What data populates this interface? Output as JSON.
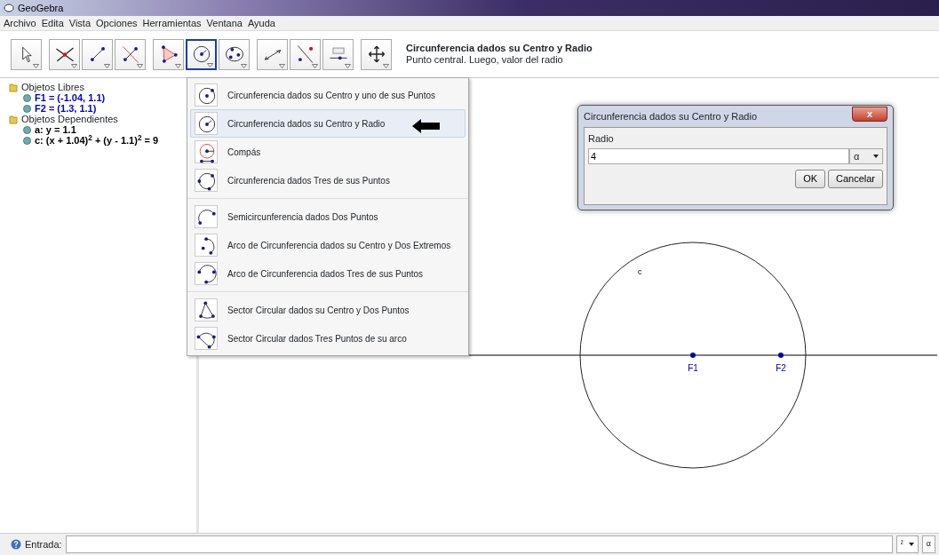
{
  "window": {
    "title": "GeoGebra"
  },
  "menu_bar": [
    "Archivo",
    "Edita",
    "Vista",
    "Opciones",
    "Herramientas",
    "Ventana",
    "Ayuda"
  ],
  "toolbar": [
    {
      "kind": "move",
      "selected": false
    },
    {
      "kind": "intersect",
      "selected": false
    },
    {
      "kind": "segment",
      "selected": false
    },
    {
      "kind": "perpendicular",
      "selected": false
    },
    {
      "kind": "polygon",
      "selected": false
    },
    {
      "kind": "circle_center_radius",
      "selected": true
    },
    {
      "kind": "ellipse",
      "selected": false
    },
    {
      "kind": "distance",
      "selected": false
    },
    {
      "kind": "line_point",
      "selected": false
    },
    {
      "kind": "slider",
      "selected": false
    },
    {
      "kind": "move_view",
      "selected": false
    }
  ],
  "tool_help": {
    "title": "Circunferencia dados su Centro y Radio",
    "description": "Punto central. Luego, valor del radio"
  },
  "algebra": [
    {
      "label": "Objetos Libres",
      "children": [
        {
          "label": "F1 = (-1.04, 1.1)",
          "color": "#0000cc"
        },
        {
          "label": "F2 = (1.3, 1.1)",
          "color": "#0000cc"
        }
      ]
    },
    {
      "label": "Objetos Dependientes",
      "children": [
        {
          "label": "a: y = 1.1",
          "color": "#000000"
        },
        {
          "label": "c: (x + 1.04)$^{2}$ + (y - 1.1)$^{2}$ = 9",
          "color": "#000000"
        }
      ]
    }
  ],
  "tool_menu": [
    [
      {
        "kind": "circle_center_point",
        "label": "Circunferencia dados su Centro y uno de sus Puntos",
        "selected": false
      },
      {
        "kind": "circle_center_radius",
        "label": "Circunferencia dados su Centro y Radio",
        "selected": true
      },
      {
        "kind": "compass",
        "label": "Compás",
        "selected": false
      },
      {
        "kind": "circle_three_points",
        "label": "Circunferencia dados Tres de sus Puntos",
        "selected": false
      }
    ],
    [
      {
        "kind": "semicircle",
        "label": "Semicircunferencia dados Dos Puntos",
        "selected": false
      },
      {
        "kind": "arc_center",
        "label": "Arco de Circunferencia dados su Centro y Dos Extremos",
        "selected": false
      },
      {
        "kind": "arc_three_points",
        "label": "Arco de Circunferencia dados Tres de sus Puntos",
        "selected": false
      }
    ],
    [
      {
        "kind": "sector_center",
        "label": "Sector Circular dados su Centro y Dos Puntos",
        "selected": false
      },
      {
        "kind": "sector_three_points",
        "label": "Sector Circular dados Tres Puntos de su arco",
        "selected": false
      }
    ]
  ],
  "dialog": {
    "title": "Circunferencia dados su Centro y Radio",
    "close": "x",
    "label": "Radio",
    "value": "4",
    "symbol": "α",
    "buttons": [
      "OK",
      "Cancelar"
    ]
  },
  "graphics": {
    "circle_label": "c",
    "points": [
      "F1",
      "F2"
    ]
  },
  "input_bar": {
    "label": "Entrada:",
    "symbol_menu": "²",
    "greek": "α"
  }
}
